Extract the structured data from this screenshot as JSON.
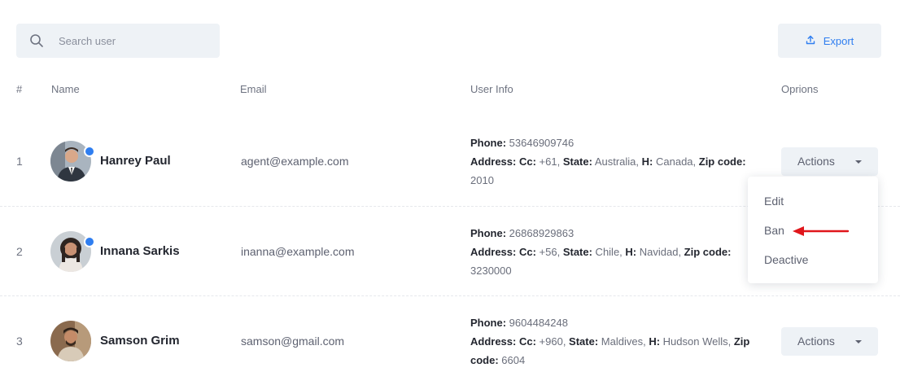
{
  "search": {
    "placeholder": "Search user"
  },
  "export": {
    "label": "Export"
  },
  "table": {
    "headers": {
      "index": "#",
      "name": "Name",
      "email": "Email",
      "user_info": "User Info",
      "options": "Oprions"
    },
    "rows": [
      {
        "index": "1",
        "name": "Hanrey Paul",
        "email": "agent@example.com",
        "online": true,
        "phone_label": "Phone:",
        "phone": " 53646909746",
        "address_label": "Address:",
        "cc_label": " Cc:",
        "cc": " +61,",
        "state_label": " State:",
        "state": " Australia,",
        "h_label": " H:",
        "h": " Canada,",
        "zip_label": " Zip code:",
        "zip": " 2010",
        "actions_label": "Actions"
      },
      {
        "index": "2",
        "name": "Innana Sarkis",
        "email": "inanna@example.com",
        "online": true,
        "phone_label": "Phone:",
        "phone": " 26868929863",
        "address_label": "Address:",
        "cc_label": " Cc:",
        "cc": " +56,",
        "state_label": " State:",
        "state": " Chile,",
        "h_label": " H:",
        "h": " Navidad,",
        "zip_label": " Zip code:",
        "zip": " 3230000",
        "actions_label": "Actions"
      },
      {
        "index": "3",
        "name": "Samson Grim",
        "email": "samson@gmail.com",
        "online": false,
        "phone_label": "Phone:",
        "phone": " 9604484248",
        "address_label": "Address:",
        "cc_label": " Cc:",
        "cc": " +960,",
        "state_label": " State:",
        "state": " Maldives,",
        "h_label": " H:",
        "h": " Hudson Wells,",
        "zip_label": " Zip code:",
        "zip": " 6604",
        "actions_label": "Actions"
      }
    ]
  },
  "dropdown": {
    "items": [
      "Edit",
      "Ban",
      "Deactive"
    ]
  },
  "colors": {
    "accent": "#2f7ef0",
    "button_bg": "#eef2f6",
    "annotation_arrow": "#e0161b"
  },
  "icons": {
    "search": "search-icon",
    "export": "upload-icon",
    "caret": "caret-down-icon"
  }
}
